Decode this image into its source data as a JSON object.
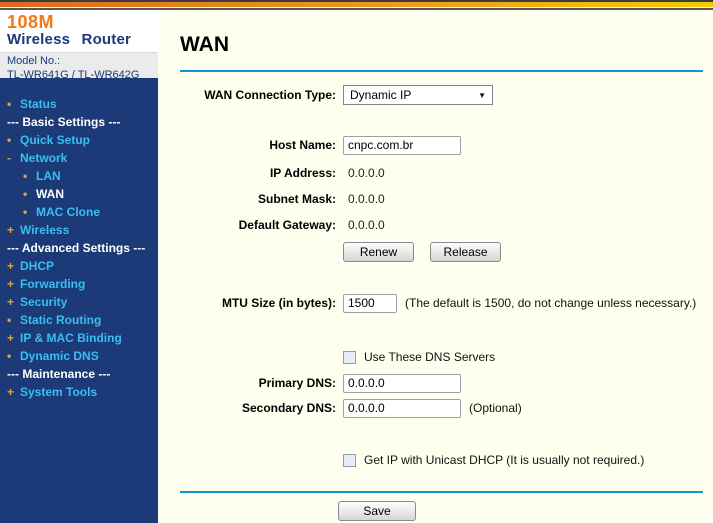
{
  "brand": {
    "speed": "108M",
    "product": "Wireless Router",
    "model_label": "Model No.:",
    "model_value": "TL-WR641G / TL-WR642G"
  },
  "sidebar": {
    "items": [
      {
        "prefix": "•",
        "label": "Status"
      },
      {
        "prefix": "",
        "label": "--- Basic Settings ---"
      },
      {
        "prefix": "•",
        "label": "Quick Setup"
      },
      {
        "prefix": "-",
        "label": "Network"
      },
      {
        "prefix": "•",
        "label": "LAN"
      },
      {
        "prefix": "•",
        "label": "WAN"
      },
      {
        "prefix": "•",
        "label": "MAC Clone"
      },
      {
        "prefix": "+",
        "label": "Wireless"
      },
      {
        "prefix": "",
        "label": "--- Advanced Settings ---"
      },
      {
        "prefix": "+",
        "label": "DHCP"
      },
      {
        "prefix": "+",
        "label": "Forwarding"
      },
      {
        "prefix": "+",
        "label": "Security"
      },
      {
        "prefix": "•",
        "label": "Static Routing"
      },
      {
        "prefix": "+",
        "label": "IP & MAC Binding"
      },
      {
        "prefix": "•",
        "label": "Dynamic DNS"
      },
      {
        "prefix": "",
        "label": "--- Maintenance ---"
      },
      {
        "prefix": "+",
        "label": "System Tools"
      }
    ]
  },
  "main": {
    "title": "WAN",
    "connection_type": {
      "label": "WAN Connection Type:",
      "value": "Dynamic IP"
    },
    "host_name": {
      "label": "Host Name:",
      "value": "cnpc.com.br"
    },
    "ip_address": {
      "label": "IP Address:",
      "value": "0.0.0.0"
    },
    "subnet_mask": {
      "label": "Subnet Mask:",
      "value": "0.0.0.0"
    },
    "default_gateway": {
      "label": "Default Gateway:",
      "value": "0.0.0.0"
    },
    "renew_button": "Renew",
    "release_button": "Release",
    "mtu": {
      "label": "MTU Size (in bytes):",
      "value": "1500",
      "note": "(The default is 1500, do not change unless necessary.)"
    },
    "use_dns_checkbox_label": "Use These DNS Servers",
    "primary_dns": {
      "label": "Primary DNS:",
      "value": "0.0.0.0"
    },
    "secondary_dns": {
      "label": "Secondary DNS:",
      "value": "0.0.0.0",
      "note": "(Optional)"
    },
    "unicast_checkbox_label": "Get IP with Unicast DHCP (It is usually not required.)",
    "save_button": "Save"
  },
  "colors": {
    "accent_orange": "#F07818",
    "topbar_gradient_left": "#DB6A1E",
    "topbar_gradient_right": "#F2CB05",
    "sidebar_bg": "#1B3A77",
    "sidebar_link": "#38BFF2",
    "sidebar_bullet": "#E2A33C",
    "content_bg": "#FFFFF0",
    "divider_blue": "#1296D3"
  }
}
